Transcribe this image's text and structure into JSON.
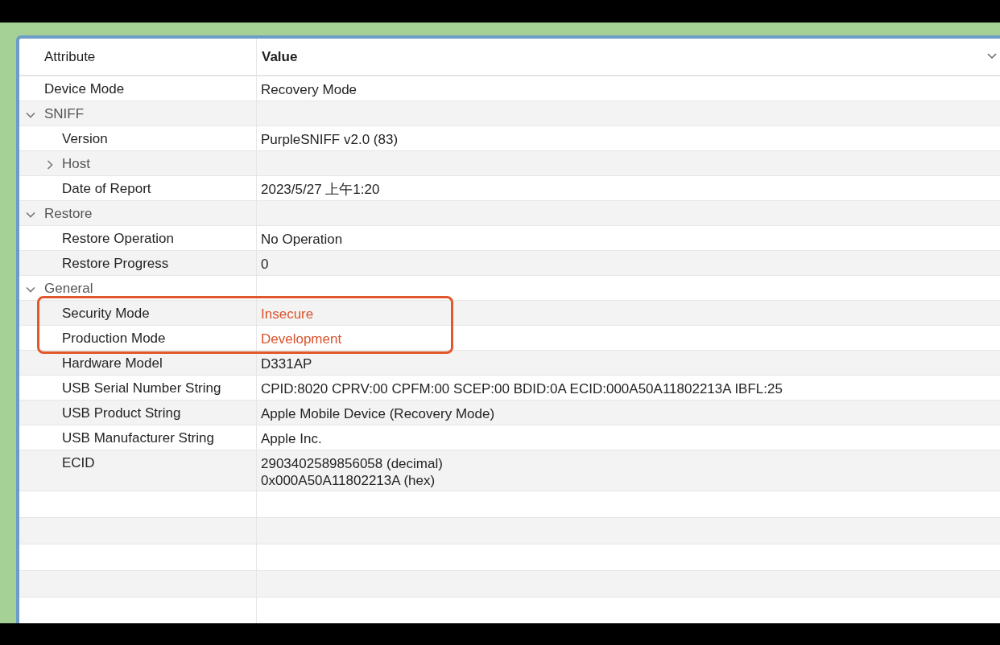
{
  "columns": [
    {
      "label": "Attribute",
      "bold": false
    },
    {
      "label": "Value",
      "bold": true
    }
  ],
  "rows": [
    {
      "attribute": "Device Mode",
      "value": "Recovery Mode",
      "highlighted": false
    },
    {
      "attribute": "SNIFF",
      "expanded": true,
      "children": [
        {
          "attribute": "Version",
          "value": "PurpleSNIFF v2.0 (83)",
          "highlighted": false
        },
        {
          "attribute": "Host",
          "expanded": false
        },
        {
          "attribute": "Date of Report",
          "value": "2023/5/27 上午1:20",
          "highlighted": false
        }
      ]
    },
    {
      "attribute": "Restore",
      "expanded": true,
      "children": [
        {
          "attribute": "Restore Operation",
          "value": "No Operation",
          "highlighted": false
        },
        {
          "attribute": "Restore Progress",
          "value": "0",
          "highlighted": false
        }
      ]
    },
    {
      "attribute": "General",
      "expanded": true,
      "children": [
        {
          "attribute": "Security Mode",
          "value": "Insecure",
          "highlighted": true
        },
        {
          "attribute": "Production Mode",
          "value": "Development",
          "highlighted": true
        },
        {
          "attribute": "Hardware Model",
          "value": "D331AP",
          "highlighted": false
        },
        {
          "attribute": "USB Serial Number String",
          "value": "CPID:8020 CPRV:00 CPFM:00 SCEP:00 BDID:0A ECID:000A50A11802213A IBFL:25",
          "highlighted": false
        },
        {
          "attribute": "USB Product String",
          "value": "Apple Mobile Device (Recovery Mode)",
          "highlighted": false
        },
        {
          "attribute": "USB Manufacturer String",
          "value": "Apple Inc.",
          "highlighted": false
        },
        {
          "attribute": "ECID",
          "value": "2903402589856058 (decimal)\n0x000A50A11802213A (hex)",
          "highlighted": false
        }
      ]
    }
  ]
}
